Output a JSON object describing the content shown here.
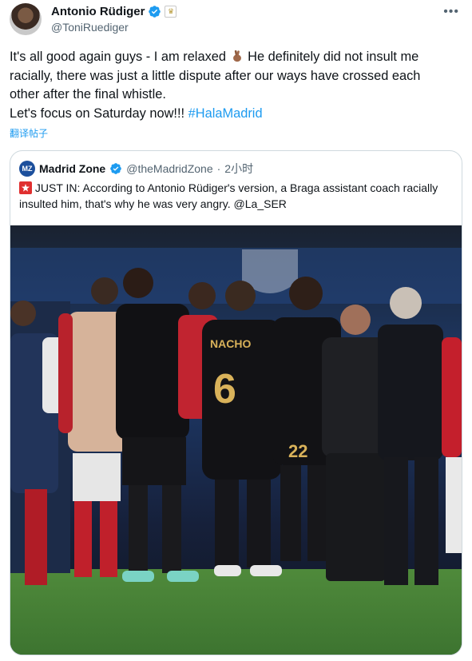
{
  "tweet": {
    "author": {
      "name": "Antonio Rüdiger",
      "handle": "@ToniRuediger",
      "verified": true,
      "affiliation_badge": "real-madrid-crest-icon"
    },
    "more_icon": "more-icon",
    "text_lines": [
      "It's all good again guys - I am relaxed",
      "He definitely did not insult me",
      "racially, there was just a little dispute after our ways have crossed each",
      "other after the final whistle.",
      "Let's focus on Saturday now!!!",
      "#HalaMadrid"
    ],
    "emoji": "crossed-fingers-emoji",
    "translate_label": "翻译帖子",
    "hashtag_color": "#1d9bf0"
  },
  "quoted_tweet": {
    "author": {
      "name": "Madrid Zone",
      "avatar_text": "MZ",
      "handle": "@theMadridZone",
      "separator": "·",
      "time": "2小时",
      "verified": true
    },
    "emoji": "siren-emoji",
    "text": "JUST IN: According to Antonio Rüdiger's version, a Braga assistant coach racially insulted him, that's why he was very angry. @La_SER",
    "photo": {
      "description_icon": "match-photo-image",
      "jersey_name": "NACHO",
      "jersey_number": "6",
      "second_number": "22"
    }
  }
}
